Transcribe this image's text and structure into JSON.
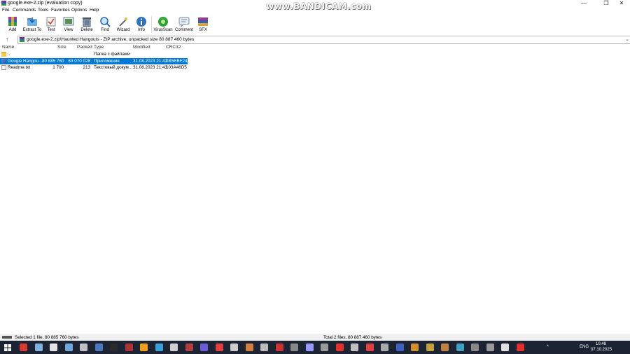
{
  "window": {
    "title": "google.exe-2.zip (evaluation copy)"
  },
  "watermark": "www.BANDICAM.com",
  "window_controls": {
    "minimize": "—",
    "maximize": "❐",
    "close": "✕"
  },
  "menu": [
    "File",
    "Commands",
    "Tools",
    "Favorites",
    "Options",
    "Help"
  ],
  "toolbar": [
    {
      "label": "Add",
      "icon": "add-icon",
      "color": "#b84a9a"
    },
    {
      "label": "Extract To",
      "icon": "extract-folder-icon",
      "color": "#4f9ad8"
    },
    {
      "label": "Test",
      "icon": "test-icon",
      "color": "#c94a3a"
    },
    {
      "label": "View",
      "icon": "view-icon",
      "color": "#5b8f4e"
    },
    {
      "label": "Delete",
      "icon": "trash-icon",
      "color": "#6b7f99"
    },
    {
      "label": "Find",
      "icon": "magnifier-icon",
      "color": "#2c6bb8"
    },
    {
      "label": "Wizard",
      "icon": "wand-icon",
      "color": "#d7b13a"
    },
    {
      "label": "Info",
      "icon": "info-icon",
      "color": "#2e72c2"
    },
    {
      "label": "VirusScan",
      "icon": "virus-scan-icon",
      "color": "#2fa333"
    },
    {
      "label": "Comment",
      "icon": "comment-icon",
      "color": "#7a8aa0"
    },
    {
      "label": "SFX",
      "icon": "sfx-icon",
      "color": "#e0a030"
    }
  ],
  "address": {
    "up": "↑",
    "path": "google.exe-2.zip\\Haunted Hangouts - ZIP archive, unpacked size 80 887 460 bytes",
    "dropdown": "⌄"
  },
  "columns": {
    "name": "Name",
    "size": "Size",
    "packed": "Packed",
    "type": "Type",
    "modified": "Modified",
    "crc": "CRC32"
  },
  "rows": [
    {
      "name": "..",
      "size": "",
      "packed": "",
      "type": "Папка с файлами",
      "modified": "",
      "crc": "",
      "icon": "folder-icon"
    },
    {
      "name": "Google Hangou...",
      "size": "80 885 760",
      "packed": "63 070 028",
      "type": "Приложение",
      "modified": "31.08.2023 21:42",
      "crc": "0B5EBF24",
      "icon": "exe-icon"
    },
    {
      "name": "Readme.txt",
      "size": "1 700",
      "packed": "213",
      "type": "Текстовый докум...",
      "modified": "31.08.2023 21:43",
      "crc": "103A46D5",
      "icon": "text-file-icon"
    }
  ],
  "status": {
    "left": "Selected 1 file, 80 885 760 bytes",
    "right": "Total 2 files, 80 887 460 bytes"
  },
  "taskbar": {
    "tray": {
      "lang": "ENG",
      "time": "10:48",
      "date": "07.10.2025",
      "chevron": "^"
    },
    "icon_colors": [
      "#d63b2f",
      "#7fb2e0",
      "#e3e3e3",
      "#6fa8dc",
      "#c0c0c0",
      "#4b77be",
      "#2b2b2b",
      "#a33",
      "#f0a020",
      "#3aa0d8",
      "#cfcfcf",
      "#b04040",
      "#6b5bd8",
      "#e04040",
      "#cccccc",
      "#d08040",
      "#bbbbbb",
      "#cc3333",
      "#888888",
      "#9999ff",
      "#999999",
      "#e03030",
      "#c0c0c0",
      "#e04040",
      "#aaaaaa",
      "#4060c0",
      "#d09030",
      "#c0a040",
      "#c08040",
      "#40a0c0",
      "#888888",
      "#999999",
      "#e0e0e0",
      "#e03030"
    ]
  }
}
